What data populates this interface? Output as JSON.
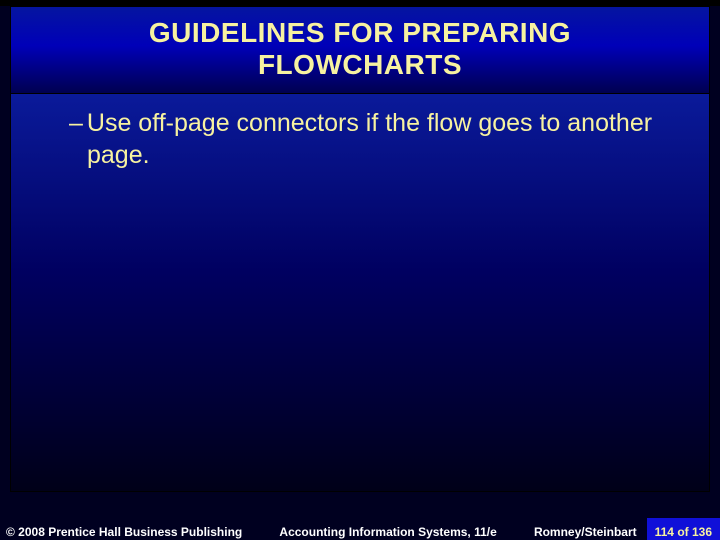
{
  "title_line1": "GUIDELINES FOR PREPARING",
  "title_line2": "FLOWCHARTS",
  "bullet": "Use off-page connectors if the flow goes to another page.",
  "footer": {
    "copyright": "© 2008 Prentice Hall Business Publishing",
    "center": "Accounting Information Systems, 11/e",
    "authors": "Romney/Steinbart",
    "pager": "114 of 136"
  }
}
